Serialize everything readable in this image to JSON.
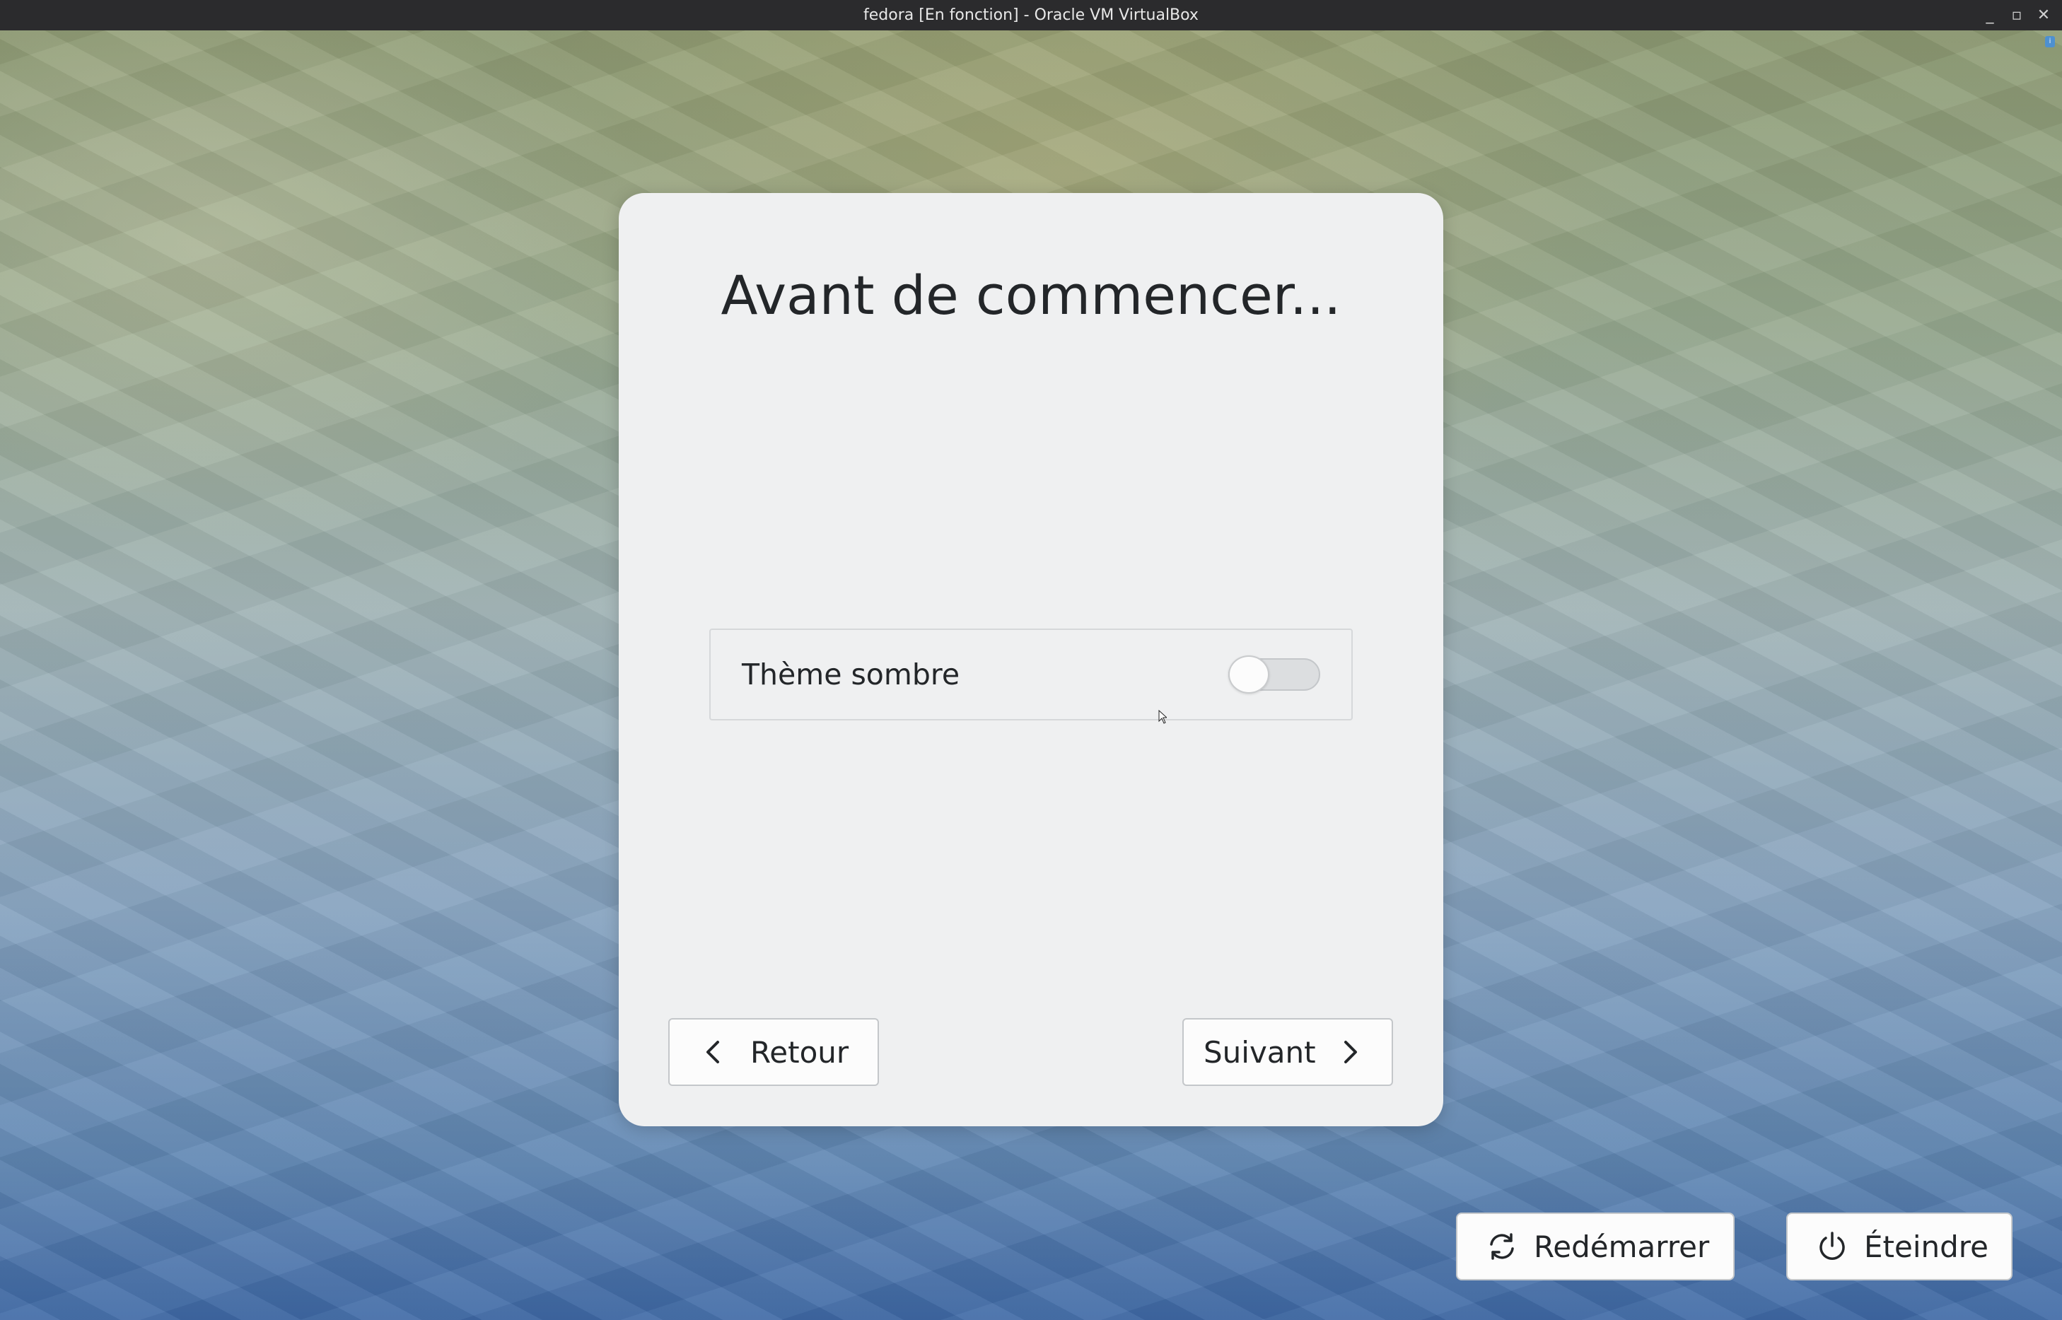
{
  "window": {
    "title": "fedora [En fonction] - Oracle VM VirtualBox",
    "controls": [
      {
        "icon": "minimize-icon",
        "glyph": "_"
      },
      {
        "icon": "maximize-icon",
        "glyph": "▫"
      },
      {
        "icon": "close-icon",
        "glyph": "✕"
      }
    ]
  },
  "dialog": {
    "title": "Avant de commencer...",
    "setting": {
      "label": "Thème sombre",
      "enabled": false
    },
    "back_label": "Retour",
    "next_label": "Suivant"
  },
  "power": {
    "restart_label": "Redémarrer",
    "shutdown_label": "Éteindre"
  },
  "colors": {
    "card_background": "#eff0f1",
    "text": "#232629",
    "titlebar": "#2b2b2d"
  }
}
